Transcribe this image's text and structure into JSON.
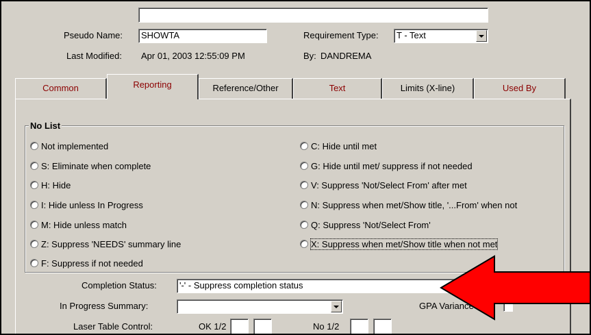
{
  "header": {
    "top_field_value": "",
    "pseudo_name_label": "Pseudo Name:",
    "pseudo_name_value": "SHOWTA",
    "requirement_type_label": "Requirement Type:",
    "requirement_type_value": "T - Text",
    "last_modified_label": "Last Modified:",
    "last_modified_value": "Apr 01, 2003  12:55:09 PM",
    "by_label": "By:",
    "by_value": "DANDREMA"
  },
  "tabs": [
    {
      "label": "Common"
    },
    {
      "label": "Reporting"
    },
    {
      "label": "Reference/Other"
    },
    {
      "label": "Text"
    },
    {
      "label": "Limits (X-line)"
    },
    {
      "label": "Used By"
    }
  ],
  "group": {
    "title": "No List",
    "left_options": [
      "Not implemented",
      "S: Eliminate when complete",
      "H: Hide",
      "I: Hide unless In Progress",
      "M: Hide unless match",
      "Z: Suppress 'NEEDS' summary line",
      "F: Suppress if not needed"
    ],
    "right_options": [
      "C: Hide until met",
      "G: Hide until met/ suppress if not needed",
      "V: Suppress 'Not/Select From' after met",
      "N: Suppress when met/Show title, '...From' when not",
      "Q: Suppress 'Not/Select From'",
      "X: Suppress when met/Show title when not met"
    ]
  },
  "completion_status": {
    "label": "Completion Status:",
    "value": "'-' - Suppress completion status"
  },
  "in_progress_summary": {
    "label": "In Progress Summary:",
    "value": ""
  },
  "gpa_variance": {
    "label": "GPA Variance"
  },
  "laser_table": {
    "label": "Laser Table Control:",
    "ok_label": "OK 1/2",
    "no_label": "No 1/2"
  },
  "colors": {
    "tab_text": "#8b0000",
    "arrow": "#ff0000",
    "dialog_bg": "#d4d0c8"
  }
}
